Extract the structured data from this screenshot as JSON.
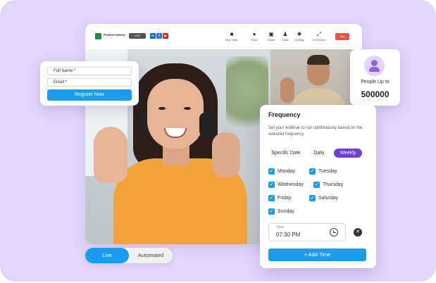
{
  "app": {
    "name": "Product Demo",
    "badge": "LIVE",
    "social": [
      "in",
      "f",
      "▶"
    ],
    "toolbar": [
      {
        "icon": "video-camera-icon",
        "label": "Stop Video"
      },
      {
        "icon": "microphone-icon",
        "label": "Mute"
      },
      {
        "icon": "share-screen-icon",
        "label": "Share"
      },
      {
        "icon": "invite-icon",
        "label": "Invite"
      },
      {
        "icon": "settings-icon",
        "label": "Settings"
      },
      {
        "icon": "fullscreen-icon",
        "label": "Full Screen"
      }
    ],
    "exit_label": "Exit"
  },
  "register": {
    "full_name_placeholder": "Full Name *",
    "email_placeholder": "Email *",
    "button_label": "Register Now"
  },
  "people": {
    "label": "People Up to",
    "value": "500000"
  },
  "frequency": {
    "title": "Frequency",
    "description": "Set your webinar to run continuously based on the selected frequency",
    "tabs": [
      "Specific Date",
      "Daily",
      "Weekly"
    ],
    "active_tab": "Weekly",
    "days": [
      {
        "label": "Monday",
        "checked": true
      },
      {
        "label": "Tuesday",
        "checked": true
      },
      {
        "label": "Wednesday",
        "checked": true
      },
      {
        "label": "Thursday",
        "checked": true
      },
      {
        "label": "Friday",
        "checked": true
      },
      {
        "label": "Saturday",
        "checked": true
      },
      {
        "label": "Sunday",
        "checked": true
      }
    ],
    "time_label": "Time",
    "time_value": "07:30 PM",
    "add_label": "+ Add Time"
  },
  "mode_toggle": {
    "options": [
      "Live",
      "Automated"
    ],
    "selected": "Live"
  },
  "colors": {
    "background": "#e2d6fb",
    "primary": "#1a9cf0",
    "accent": "#6c3fd8",
    "exit": "#e8504a"
  }
}
